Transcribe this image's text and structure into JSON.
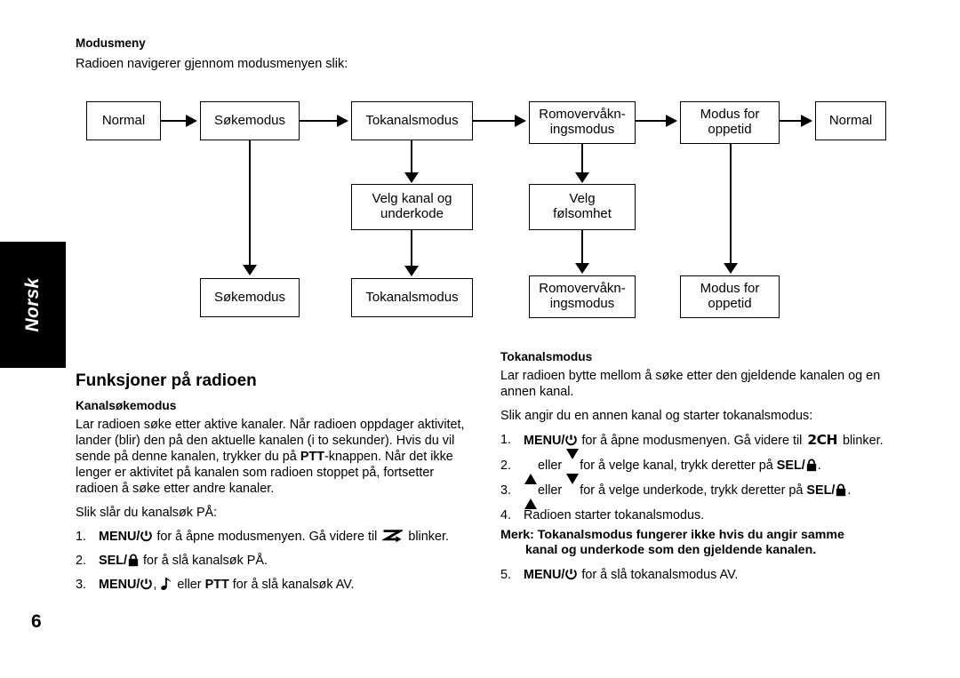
{
  "language_tab": {
    "label": "Norsk"
  },
  "page_number": "6",
  "mode_menu": {
    "heading": "Modusmeny",
    "intro": "Radioen navigerer gjennom modusmenyen slik:"
  },
  "flowchart": {
    "row1": [
      {
        "label": "Normal"
      },
      {
        "label": "Søkemodus"
      },
      {
        "label": "Tokanalsmodus"
      },
      {
        "line1": "Romovervåkn-",
        "line2": "ingsmodus"
      },
      {
        "line1": "Modus for",
        "line2": "oppetid"
      },
      {
        "label": "Normal"
      }
    ],
    "row2": [
      {
        "line1": "Velg kanal og",
        "line2": "underkode"
      },
      {
        "line1": "Velg",
        "line2": "følsomhet"
      }
    ],
    "row3": [
      {
        "label": "Søkemodus"
      },
      {
        "label": "Tokanalsmodus"
      },
      {
        "line1": "Romovervåkn-",
        "line2": "ingsmodus"
      },
      {
        "line1": "Modus for",
        "line2": "oppetid"
      }
    ]
  },
  "left_column": {
    "heading": "Funksjoner på radioen",
    "subheading": "Kanalsøkemodus",
    "paragraph": "Lar radioen søke etter aktive kanaler. Når radioen oppdager aktivitet, lander (blir) den på den aktuelle kanalen (i to sekunder). Hvis du vil sende på denne kanalen, trykker du på ",
    "paragraph_bold": "PTT",
    "paragraph_tail": "-knappen. Når det ikke lenger er aktivitet på kanalen som radioen stoppet på, fortsetter radioen å søke etter andre kanaler.",
    "lead_in": "Slik slår du kanalsøk PÅ:",
    "steps": [
      {
        "num": "1.",
        "bold1": "MENU/",
        "icon1": "power-icon",
        "text1": " for å åpne modusmenyen. Gå videre til ",
        "icon2": "scan-icon",
        "text2": " blinker."
      },
      {
        "num": "2.",
        "bold1": "SEL/",
        "icon1": "lock-icon",
        "text1": " for å slå kanalsøk PÅ."
      },
      {
        "num": "3.",
        "bold1": "MENU/",
        "icon1": "power-icon",
        "text1": ", ",
        "icon2": "music-note-icon",
        "text2": " eller ",
        "bold2": "PTT",
        "text3": " for å slå kanalsøk AV."
      }
    ]
  },
  "right_column": {
    "subheading": "Tokanalsmodus",
    "paragraph": "Lar radioen bytte mellom å søke etter den gjeldende kanalen og en annen kanal.",
    "lead_in": "Slik angir du en annen kanal og starter tokanalsmodus:",
    "steps": [
      {
        "num": "1.",
        "bold1": "MENU/",
        "icon1": "power-icon",
        "text1": " for å åpne modusmenyen. Gå videre til ",
        "lcd": "2CH",
        "text2": " blinker."
      },
      {
        "num": "2.",
        "icon_up": "triangle-up-icon",
        "text1": " eller ",
        "icon_down": "triangle-down-icon",
        "text2": " for å velge kanal, trykk deretter på ",
        "bold1": "SEL/",
        "icon1": "lock-icon",
        "text3": "."
      },
      {
        "num": "3.",
        "icon_up": "triangle-up-icon",
        "text1": " eller ",
        "icon_down": "triangle-down-icon",
        "text2": " for å velge underkode, trykk deretter på ",
        "bold1": "SEL/",
        "icon1": "lock-icon",
        "text3": "."
      },
      {
        "num": "4.",
        "text1": "Radioen starter tokanalsmodus."
      }
    ],
    "note_line1": "Merk: Tokanalsmodus fungerer ikke hvis du angir samme",
    "note_line2": "kanal og underkode som den gjeldende kanalen.",
    "step5": {
      "num": "5.",
      "bold1": "MENU/",
      "icon1": "power-icon",
      "text1": " for å slå tokanalsmodus AV."
    }
  },
  "colors": {
    "ink": "#000000",
    "paper": "#ffffff"
  }
}
